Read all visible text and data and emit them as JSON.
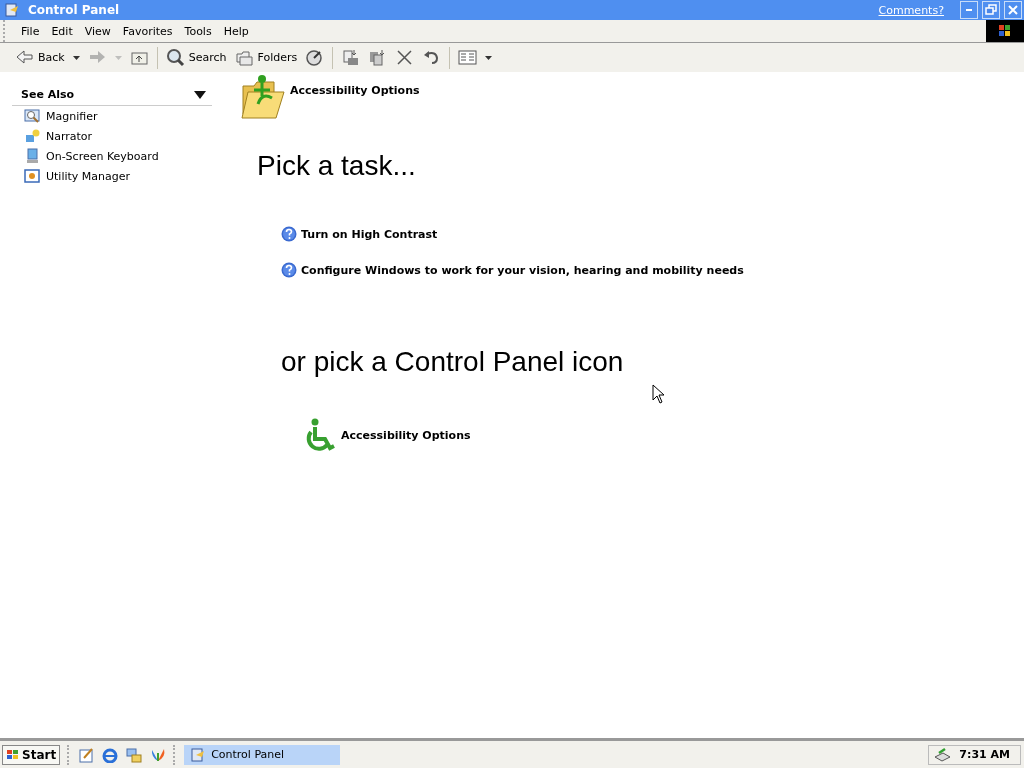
{
  "window": {
    "title": "Control Panel",
    "comments_link": "Comments?"
  },
  "menu": [
    "File",
    "Edit",
    "View",
    "Favorites",
    "Tools",
    "Help"
  ],
  "toolbar": [
    {
      "kind": "button",
      "label": "Back",
      "dropdown": true,
      "disabled": false
    },
    {
      "kind": "button",
      "dropdown": true,
      "disabled": true
    },
    {
      "kind": "button",
      "dropdown": false,
      "disabled": false
    },
    {
      "kind": "separator"
    },
    {
      "kind": "button",
      "label": "Search",
      "dropdown": false,
      "disabled": false
    },
    {
      "kind": "button",
      "label": "Folders",
      "dropdown": false,
      "disabled": false
    },
    {
      "kind": "button",
      "dropdown": false,
      "disabled": false
    },
    {
      "kind": "separator"
    },
    {
      "kind": "button",
      "dropdown": false,
      "disabled": false
    },
    {
      "kind": "button",
      "dropdown": false,
      "disabled": false
    },
    {
      "kind": "button",
      "dropdown": false,
      "disabled": false
    },
    {
      "kind": "button",
      "dropdown": false,
      "disabled": false
    },
    {
      "kind": "separator"
    },
    {
      "kind": "button",
      "dropdown": true,
      "disabled": false
    }
  ],
  "sidebar": {
    "title": "See Also",
    "expanded": true,
    "items": [
      "Magnifier",
      "Narrator",
      "On-Screen Keyboard",
      "Utility Manager"
    ]
  },
  "main": {
    "category": "Accessibility Options",
    "task_heading": "Pick a task...",
    "tasks": [
      "Turn on High Contrast",
      "Configure Windows to work for your vision, hearing and mobility needs"
    ],
    "icon_heading": "or pick a Control Panel icon",
    "icons": [
      "Accessibility Options"
    ]
  },
  "taskbar": {
    "start": "Start",
    "tasks": [
      {
        "label": "Control Panel",
        "selected": true
      }
    ],
    "clock": "7:31 AM"
  }
}
